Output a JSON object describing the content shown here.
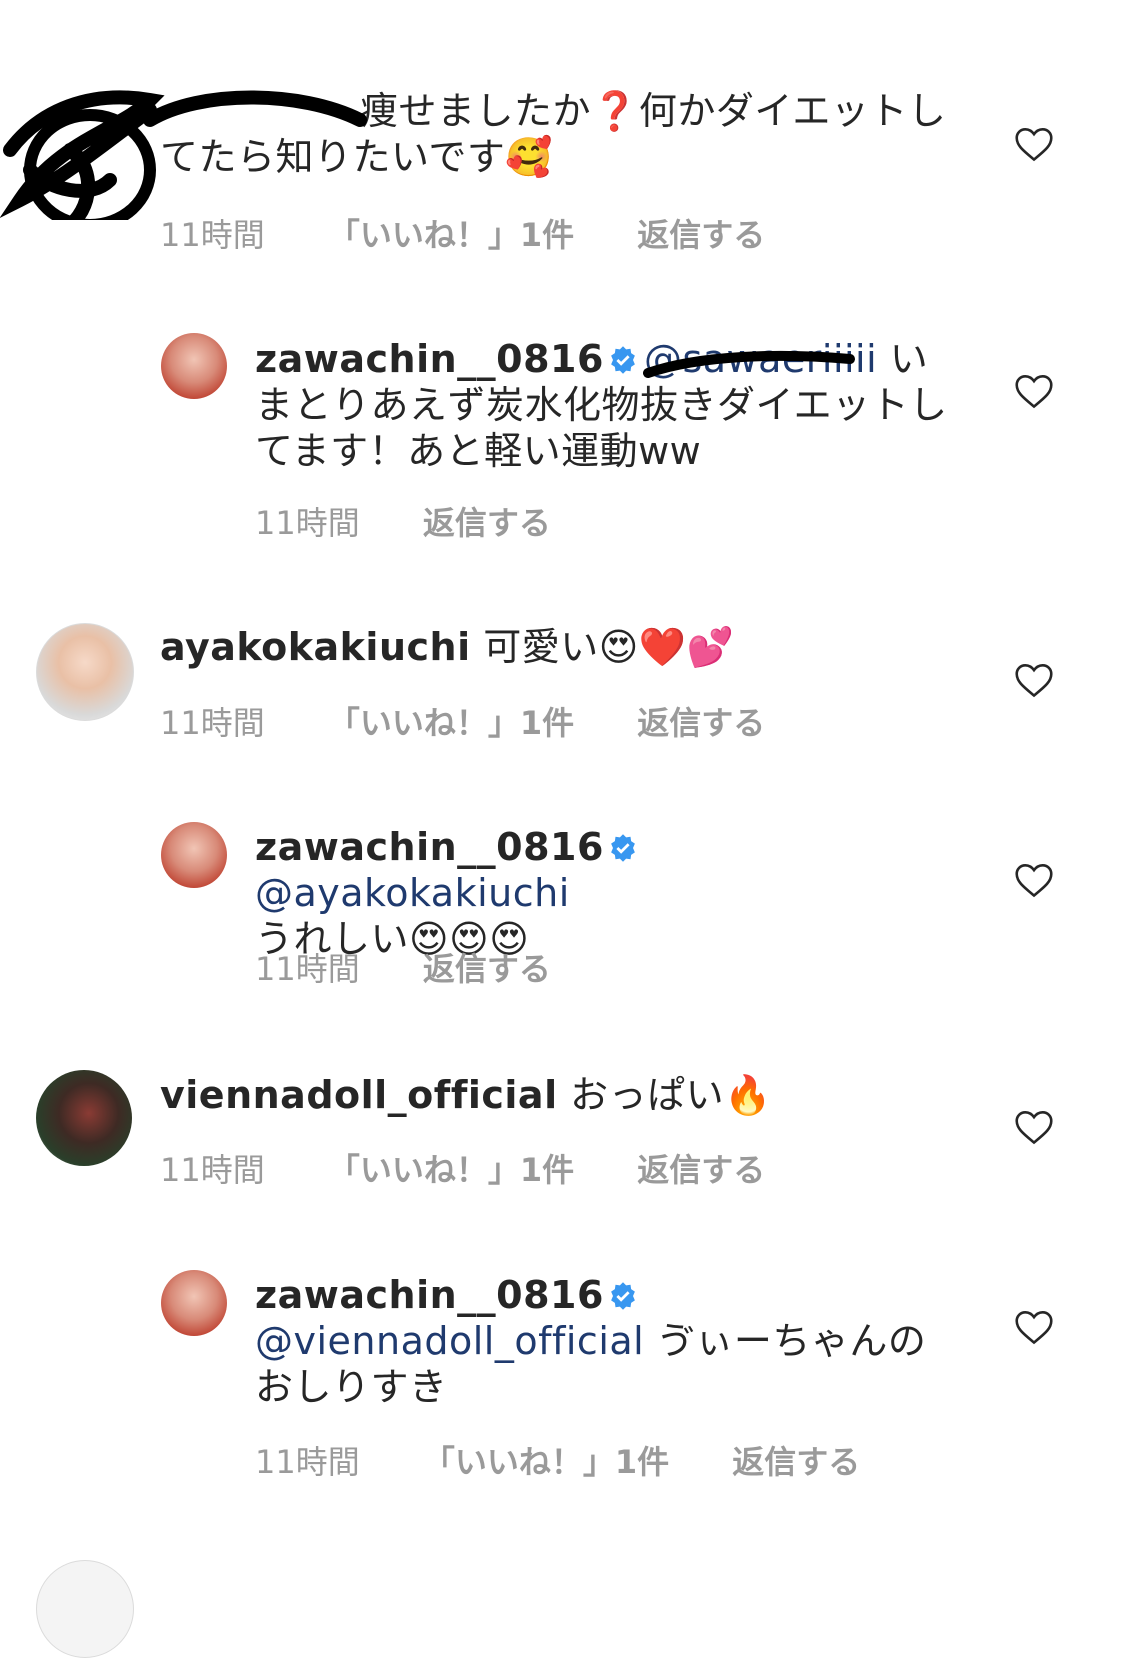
{
  "comments": [
    {
      "user": "",
      "text": "痩せましたか❓何かダイエットしてたら知りたいです🥰",
      "mention": "",
      "time": "11時間",
      "likes": "「いいね！」1件",
      "reply": "返信する"
    },
    {
      "user": "zawachin__0816",
      "mention": "@sawaeriiiii",
      "text": " いまとりあえず炭水化物抜きダイエットしてます！あと軽い運動ww",
      "time": "11時間",
      "likes": "",
      "reply": "返信する"
    },
    {
      "user": "ayakokakiuchi",
      "text": " 可愛い😍❤️💕",
      "time": "11時間",
      "likes": "「いいね！」1件",
      "reply": "返信する"
    },
    {
      "user": "zawachin__0816",
      "mention": "@ayakokakiuchi",
      "text": "うれしい😍😍😍",
      "time": "11時間",
      "likes": "",
      "reply": "返信する"
    },
    {
      "user": "viennadoll_official",
      "text": " おっぱい🔥",
      "time": "11時間",
      "likes": "「いいね！」1件",
      "reply": "返信する"
    },
    {
      "user": "zawachin__0816",
      "mention": "@viennadoll_official",
      "text": " ゔぃーちゃんのおしりすき",
      "time": "11時間",
      "likes": "「いいね！」1件",
      "reply": "返信する"
    }
  ],
  "colors": {
    "verified": "#3897f0",
    "mention": "#1f3a6e",
    "meta": "#9a9a9a"
  },
  "icons": {
    "like": "heart-outline-icon",
    "verified": "verified-badge-icon"
  }
}
